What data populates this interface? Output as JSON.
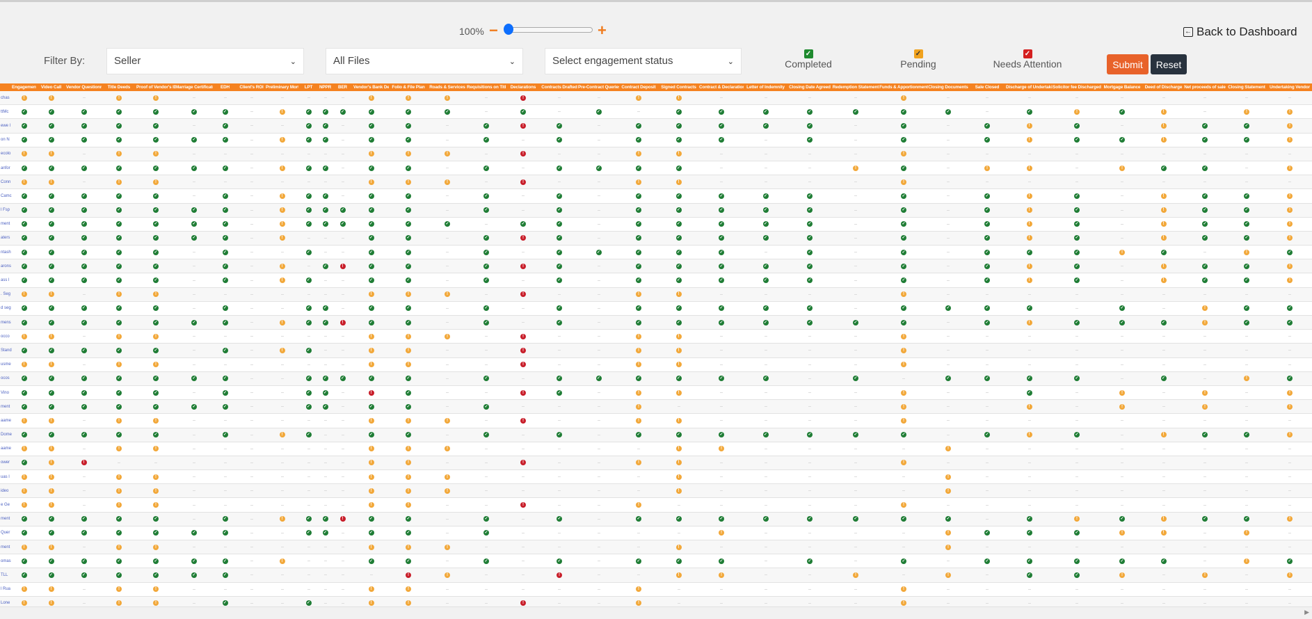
{
  "zoom": {
    "level": "100%",
    "minus": "−",
    "plus": "+",
    "slider_value_percent": 0
  },
  "back_label": "Back to Dashboard",
  "filter": {
    "label": "Filter By:",
    "role": "Seller",
    "files": "All Files",
    "status_placeholder": "Select engagement status"
  },
  "legend": [
    {
      "label": "Completed",
      "color": "#1e8a2e"
    },
    {
      "label": "Pending",
      "color": "#f0a21e"
    },
    {
      "label": "Needs Attention",
      "color": "#d42020"
    }
  ],
  "buttons": {
    "submit": "Submit",
    "reset": "Reset"
  },
  "colors": {
    "g": "#1f7d35",
    "o": "#f2a83a",
    "r": "#c81e2a",
    "header": "#f58220"
  },
  "columns": [
    "Engagement",
    "Video Call",
    "Vendor Questionnaire",
    "Title Deeds",
    "Proof of Vendor's ID",
    "Marriage Certificate(s)",
    "EDH",
    "Client's ROI",
    "Preliminary Mortgage",
    "LPT",
    "NPPR",
    "BER",
    "Vendor's Bank Details",
    "Folio & File Plan",
    "Roads & Services",
    "Requisitions on Title",
    "Declarations",
    "Contracts Drafted",
    "Pre-Contract Queries",
    "Contract Deposit",
    "Signed Contracts",
    "Contract & Declarations",
    "Letter of Indemnity",
    "Closing Date Agreed",
    "Redemption Statement",
    "Funds & Apportionment",
    "Closing Documents",
    "Sale Closed",
    "Discharge of Undertaking",
    "Solicitor fee Discharged",
    "Mortgage Balance",
    "Deed of Discharge",
    "Net proceeds of sale",
    "Closing Statement",
    "Undertaking Vendor"
  ],
  "rows": [
    {
      "name": "chas",
      "s": "oo-oo-------ooo-r--oo----o---------"
    },
    {
      "name": "ttMc",
      "s": "ggggggg-ogggggg-g-g-ggggggg-gogo-ooo"
    },
    {
      "name": "ewe l",
      "s": "ggggg-g--gg-gg-grg-ggggg-g-gog-oggo"
    },
    {
      "name": "on N",
      "s": "ggggggg-ogg-gg-g-g-ggg-g-g-goggoggo"
    },
    {
      "name": "ecolo",
      "s": "oo-oo-------ooo-r--oo----o---------"
    },
    {
      "name": "anfor",
      "s": "ggggggg-ogg-gg-g-gggg---og-oo-ogg-o"
    },
    {
      "name": "Conn",
      "s": "oo-oo-------ooo-r--oo----o---------"
    },
    {
      "name": "Camc",
      "s": "ggggg-g-ogg-gg-g-g-ggggg-g-gog-oggo"
    },
    {
      "name": "l Fsp",
      "s": "ggggggg-oggggg-g-g-ggggg-g-gog-oggo"
    },
    {
      "name": "ment",
      "s": "ggggggg-ogggggg-gg-ggggg-g-gog-oggo"
    },
    {
      "name": "aters",
      "s": "ggggggg-o---gg-grg-ggggg-g-gog-oggo"
    },
    {
      "name": "ntash",
      "s": "ggggg-g--g--gg-g-ggggg-g-g-gggog-oggo"
    },
    {
      "name": "arons",
      "s": "ggggg-g-o-grgg-grg-ggggg-g-gog-oggo"
    },
    {
      "name": "ass l",
      "s": "ggggg-g-og--gg-g-g-ggggg-g-gog-oggo"
    },
    {
      "name": ". Seg",
      "s": "oo-oo-------ooo-r--oo----o---------"
    },
    {
      "name": "d seg",
      "s": "ggggg-g--gg-gg-g-g-ggggg-gggg-g-oggo"
    },
    {
      "name": "mens",
      "s": "ggggggg-oggrgg-g-g-ggggggg-gogggoggo"
    },
    {
      "name": "occo",
      "s": "oo-oo-------ooo-r--oo----o---------"
    },
    {
      "name": "Stand",
      "s": "ggggg-g-og--oo--r--oo----o---------"
    },
    {
      "name": "usme",
      "s": "oo-oo-------oo--r--oo----o---------"
    },
    {
      "name": "ocos",
      "s": "ggggggg--ggggg-g-gggggg-g-gggg-g-oggo"
    },
    {
      "name": "Vino",
      "s": "ggggg-g--gg-rg--rg-oo----o--g-o-o-oo"
    },
    {
      "name": "ment",
      "s": "ggggggg--gg-gg-g---o-----o--o-o-o-oo"
    },
    {
      "name": "aame",
      "s": "oo-oo-------ooo-r--oo----o---------"
    },
    {
      "name": "Dome",
      "s": "ggggg-g-og--gg-g-g-ggggggg-gog-oggo"
    },
    {
      "name": "aame",
      "s": "oo-oo-------ooo-----oo----o---------"
    },
    {
      "name": "ower",
      "s": "gor---------oo--r--oo----o---------"
    },
    {
      "name": "uas l",
      "s": "oo-oo-------ooo-----o-----o---------"
    },
    {
      "name": "ideo",
      "s": "oo-oo-------ooo-----o-----o---------"
    },
    {
      "name": "e Ge",
      "s": "oo-oo-------oo--r--o-----o---------"
    },
    {
      "name": "ment",
      "s": "ggggg-g-oggrgg-g-g-gggggggg-gogoggo"
    },
    {
      "name": "Quer",
      "s": "ggggggg--gg-gg-g-----o----ogggoo-o-oo"
    },
    {
      "name": "ment",
      "s": "oo-oo-------ooo-----o-----o---------"
    },
    {
      "name": "omas",
      "s": "ggggggg-o---gg-g-g-ggg-g-g-ggggg-oggo"
    },
    {
      "name": "TLL",
      "s": "ggggggg------ro--r--oo--o-o-ggo-o-oo"
    },
    {
      "name": "l Rua",
      "s": "oo-oo-------oo-----o-----o---------"
    },
    {
      "name": "Lone",
      "s": "oo-oo-g--g--oo--r--o-----o---------"
    }
  ]
}
